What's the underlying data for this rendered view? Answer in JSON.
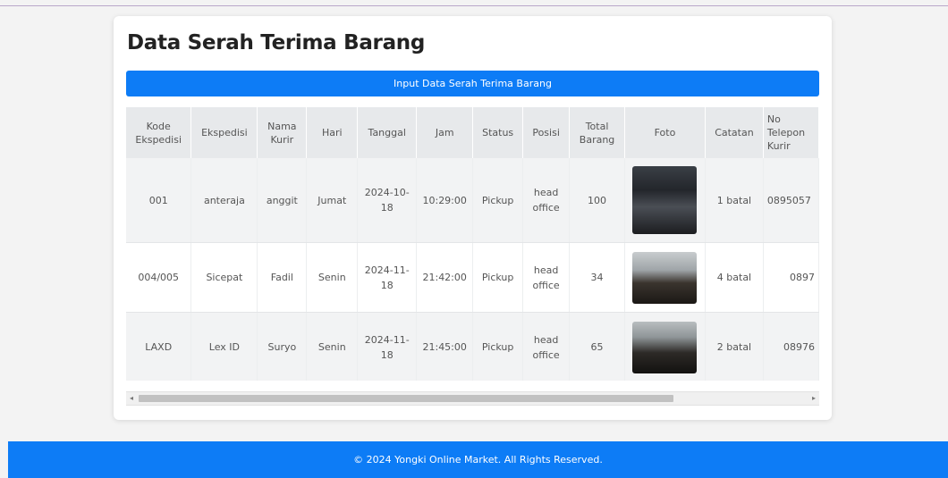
{
  "page": {
    "title": "Data Serah Terima Barang",
    "input_button_label": "Input Data Serah Terima Barang"
  },
  "table": {
    "headers": [
      "Kode Ekspedisi",
      "Ekspedisi",
      "Nama Kurir",
      "Hari",
      "Tanggal",
      "Jam",
      "Status",
      "Posisi",
      "Total Barang",
      "Foto",
      "Catatan",
      "No Telepon Kurir"
    ],
    "rows": [
      {
        "kode": "001",
        "ekspedisi": "anteraja",
        "kurir": "anggit",
        "hari": "Jumat",
        "tanggal": "2024-10-18",
        "jam": "10:29:00",
        "status": "Pickup",
        "posisi": "head office",
        "total": "100",
        "catatan": "1 batal",
        "telepon": "0895057"
      },
      {
        "kode": "004/005",
        "ekspedisi": "Sicepat",
        "kurir": "Fadil",
        "hari": "Senin",
        "tanggal": "2024-11-18",
        "jam": "21:42:00",
        "status": "Pickup",
        "posisi": "head office",
        "total": "34",
        "catatan": "4 batal",
        "telepon": "0897"
      },
      {
        "kode": "LAXD",
        "ekspedisi": "Lex ID",
        "kurir": "Suryo",
        "hari": "Senin",
        "tanggal": "2024-11-18",
        "jam": "21:45:00",
        "status": "Pickup",
        "posisi": "head office",
        "total": "65",
        "catatan": "2 batal",
        "telepon": "08976"
      }
    ]
  },
  "scrollbar": {
    "left_arrow": "◂",
    "right_arrow": "▸"
  },
  "footer": {
    "text": "© 2024 Yongki Online Market. All Rights Reserved."
  },
  "colors": {
    "accent": "#0d7cf6",
    "header_bg": "#e7e9eb",
    "page_bg": "#f3f3f3"
  }
}
